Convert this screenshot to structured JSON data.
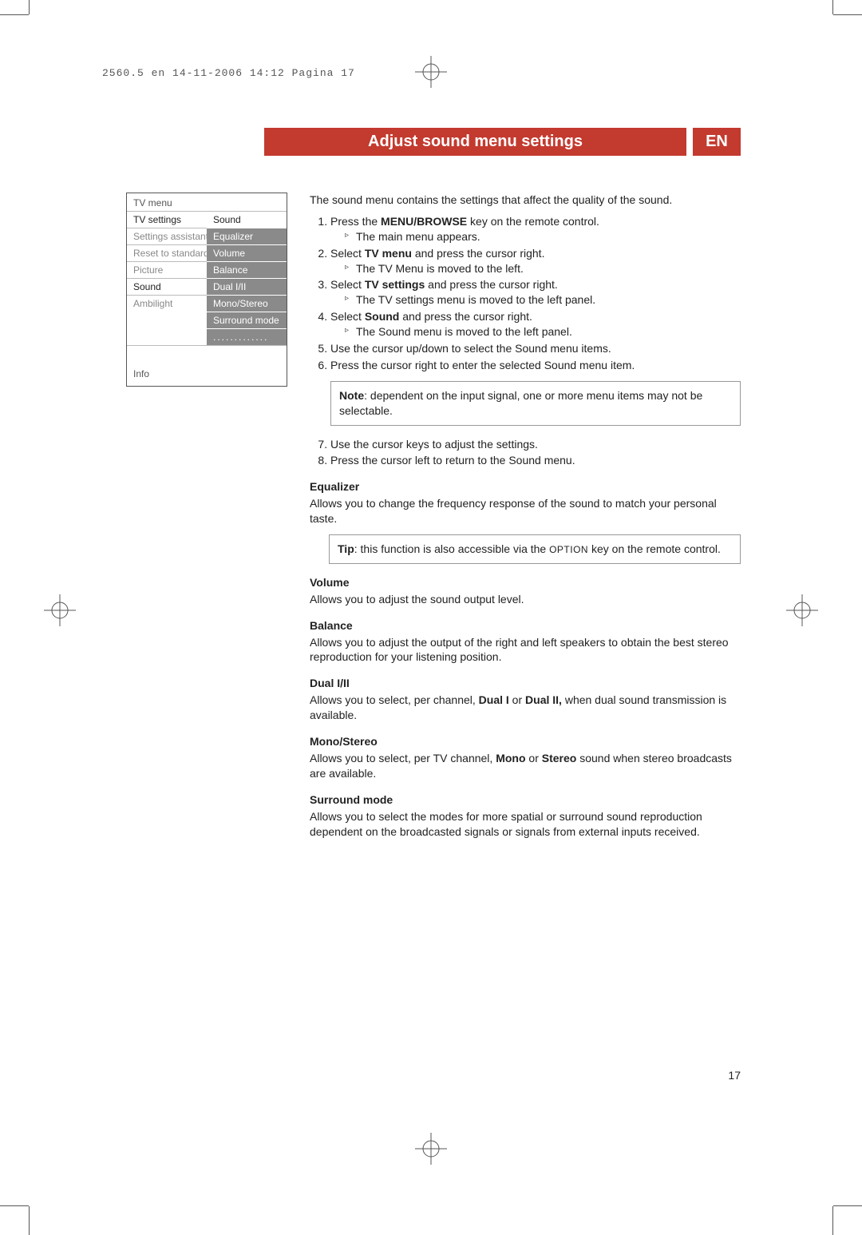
{
  "print_mark": "2560.5 en  14-11-2006  14:12  Pagina 17",
  "title": "Adjust sound menu settings",
  "lang": "EN",
  "page_number": "17",
  "menu_figure": {
    "title": "TV menu",
    "left_items": [
      {
        "label": "TV settings",
        "active": true
      },
      {
        "label": "Settings assistant",
        "active": false
      },
      {
        "label": "Reset to standard",
        "active": false
      },
      {
        "label": "Picture",
        "active": false
      },
      {
        "label": "Sound",
        "active": true
      },
      {
        "label": "Ambilight",
        "active": false
      }
    ],
    "right_head": "Sound",
    "right_items": [
      "Equalizer",
      "Volume",
      "Balance",
      "Dual I/II",
      "Mono/Stereo",
      "Surround mode"
    ],
    "right_dots": ".............",
    "info": "Info"
  },
  "intro": "The sound menu contains the settings that affect the quality of the sound.",
  "steps": [
    {
      "pre": "Press the ",
      "bold": "MENU/BROWSE",
      "post": " key on the remote control.",
      "result": "The main menu appears."
    },
    {
      "pre": "Select ",
      "bold": "TV menu",
      "post": " and press the cursor right.",
      "result": "The TV Menu is moved to the left."
    },
    {
      "pre": "Select ",
      "bold": "TV settings",
      "post": " and press the cursor right.",
      "result": "The TV settings menu is moved to the left panel."
    },
    {
      "pre": "Select ",
      "bold": "Sound",
      "post": " and press the cursor right.",
      "result": "The Sound menu is moved to the left panel."
    },
    {
      "text": "Use the cursor up/down to select the Sound menu items."
    },
    {
      "text": "Press the cursor right to enter the selected Sound menu item."
    }
  ],
  "note": {
    "label": "Note",
    "text": ": dependent on the input signal, one or more menu items may not be selectable."
  },
  "steps2": [
    {
      "n": "7.",
      "text": "Use the cursor keys to adjust the settings."
    },
    {
      "n": "8.",
      "text": "Press the cursor left to return to the Sound menu."
    }
  ],
  "sections": {
    "equalizer": {
      "h": "Equalizer",
      "body": "Allows you to change the frequency response of the sound to match your personal taste.",
      "tip_label": "Tip",
      "tip_pre": ": this function is also accessible via the ",
      "tip_key": "OPTION",
      "tip_post": " key on the remote control."
    },
    "volume": {
      "h": "Volume",
      "body": "Allows you to adjust the sound output level."
    },
    "balance": {
      "h": "Balance",
      "body": "Allows you to adjust the output of the right and left speakers to obtain the best stereo reproduction for your listening position."
    },
    "dual": {
      "h": "Dual I/II",
      "pre": "Allows you to select, per channel, ",
      "b1": "Dual I",
      "mid": " or ",
      "b2": "Dual II,",
      "post": " when dual sound transmission is available."
    },
    "mono": {
      "h": "Mono/Stereo",
      "pre": "Allows you to select, per TV channel, ",
      "b1": "Mono",
      "mid": " or ",
      "b2": "Stereo",
      "post": " sound when stereo broadcasts are available."
    },
    "surround": {
      "h": "Surround mode",
      "body": "Allows you to select the modes for more spatial or surround sound reproduction dependent on the broadcasted signals or signals from external inputs received."
    }
  }
}
